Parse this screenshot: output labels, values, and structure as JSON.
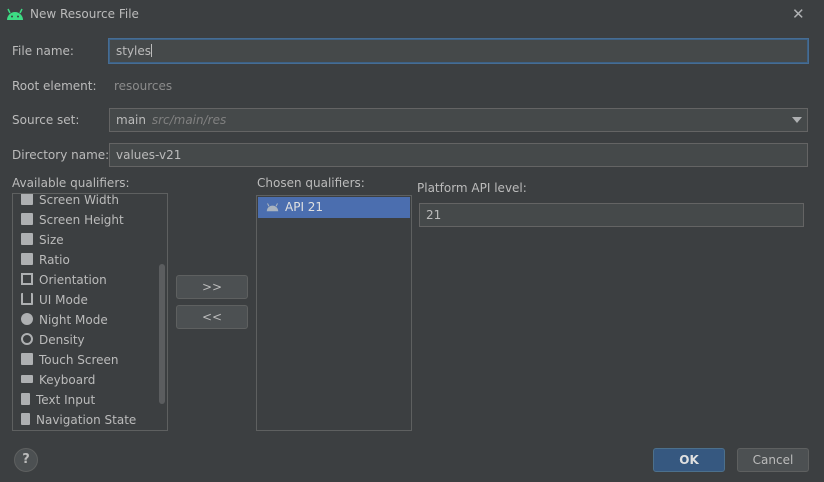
{
  "window": {
    "title": "New Resource File",
    "close_glyph": "✕"
  },
  "form": {
    "file_name_label": "File name:",
    "file_name_value": "styles",
    "root_element_label": "Root element:",
    "root_element_value": "resources",
    "source_set_label": "Source set:",
    "source_set_value": "main",
    "source_set_path": "src/main/res",
    "directory_name_label": "Directory name:",
    "directory_name_value": "values-v21"
  },
  "available": {
    "label": "Available qualifiers:",
    "items": [
      {
        "label": "Screen Width",
        "icon": "screen-width-icon"
      },
      {
        "label": "Screen Height",
        "icon": "screen-height-icon"
      },
      {
        "label": "Size",
        "icon": "size-icon"
      },
      {
        "label": "Ratio",
        "icon": "ratio-icon"
      },
      {
        "label": "Orientation",
        "icon": "orientation-icon"
      },
      {
        "label": "UI Mode",
        "icon": "ui-mode-icon"
      },
      {
        "label": "Night Mode",
        "icon": "night-mode-icon"
      },
      {
        "label": "Density",
        "icon": "density-icon"
      },
      {
        "label": "Touch Screen",
        "icon": "touch-screen-icon"
      },
      {
        "label": "Keyboard",
        "icon": "keyboard-icon"
      },
      {
        "label": "Text Input",
        "icon": "text-input-icon"
      },
      {
        "label": "Navigation State",
        "icon": "navigation-state-icon"
      }
    ]
  },
  "transfer": {
    "add_label": ">>",
    "remove_label": "<<"
  },
  "chosen": {
    "label": "Chosen qualifiers:",
    "items": [
      {
        "label": "API 21",
        "icon": "android-icon",
        "selected": true
      }
    ]
  },
  "platform": {
    "label": "Platform API level:",
    "value": "21"
  },
  "footer": {
    "help_glyph": "?",
    "ok_label": "OK",
    "cancel_label": "Cancel"
  },
  "colors": {
    "selection": "#4b6eaf",
    "primary_button": "#365880",
    "focus_border": "#3d6185",
    "android_green": "#3ddc84"
  }
}
